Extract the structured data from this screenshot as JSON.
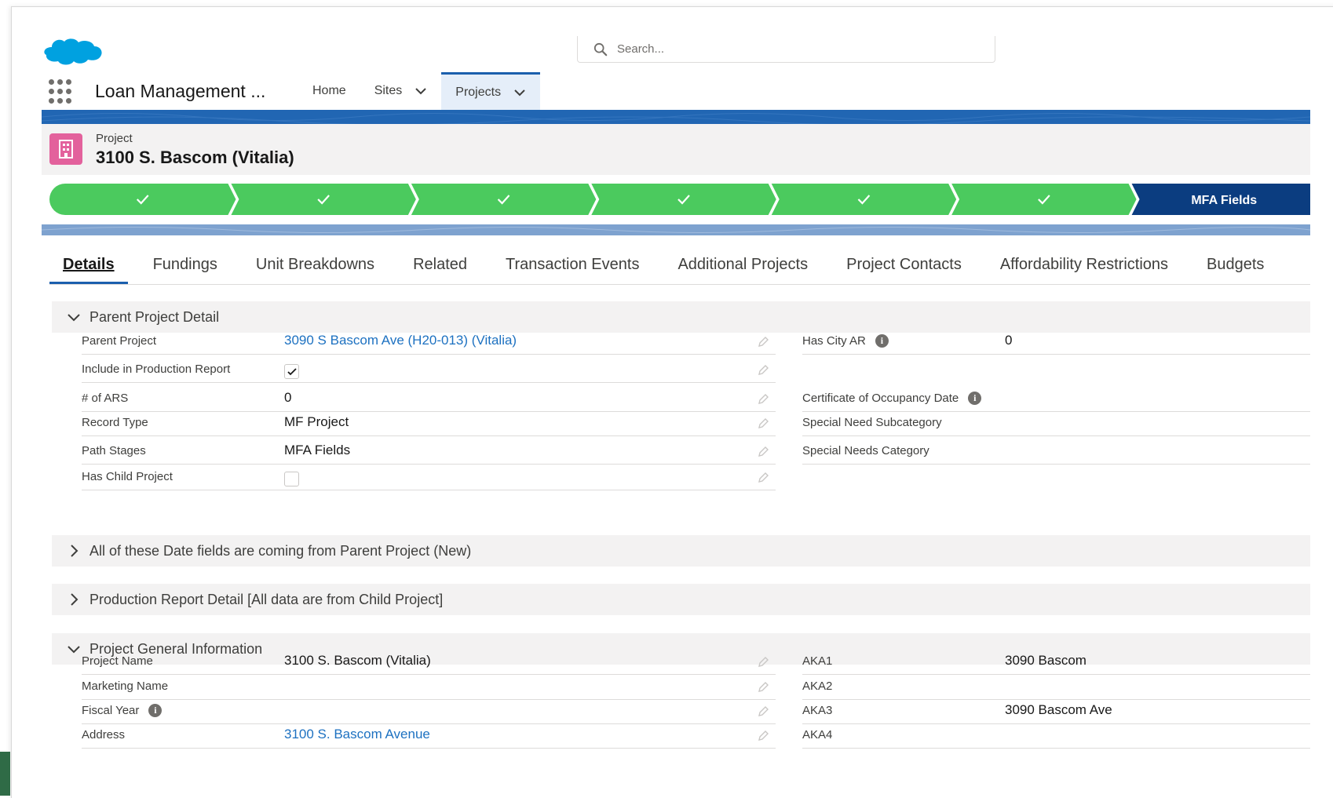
{
  "app": {
    "name": "Loan Management ..."
  },
  "search": {
    "placeholder": "Search..."
  },
  "nav": {
    "items": [
      {
        "label": "Home"
      },
      {
        "label": "Sites"
      },
      {
        "label": "Projects"
      }
    ]
  },
  "record": {
    "type": "Project",
    "name": "3100 S. Bascom (Vitalia)"
  },
  "path": {
    "current_stage": "MFA Fields",
    "completed_steps": 6
  },
  "tabs": [
    "Details",
    "Fundings",
    "Unit Breakdowns",
    "Related",
    "Transaction Events",
    "Additional Projects",
    "Project Contacts",
    "Affordability Restrictions",
    "Budgets"
  ],
  "sections": {
    "parent": {
      "title": "Parent Project Detail",
      "left": [
        {
          "label": "Parent Project",
          "value": "3090 S Bascom Ave (H20-013) (Vitalia)"
        },
        {
          "label": "Include in Production Report",
          "checked": true
        },
        {
          "label": "# of ARS",
          "value": "0"
        },
        {
          "label": "Record Type",
          "value": "MF Project"
        },
        {
          "label": "Path Stages",
          "value": "MFA Fields"
        },
        {
          "label": "Has Child Project",
          "checked": false
        }
      ],
      "right": [
        {
          "label": "Has City AR",
          "value": "0"
        },
        {
          "label": "Certificate of Occupancy Date",
          "value": ""
        },
        {
          "label": "Special Need Subcategory",
          "value": ""
        },
        {
          "label": "Special Needs Category",
          "value": ""
        }
      ]
    },
    "dates": {
      "title": "All of these Date fields are coming from Parent Project (New)"
    },
    "production": {
      "title": "Production Report Detail [All data are from Child Project]"
    },
    "general": {
      "title": "Project General Information",
      "left": [
        {
          "label": "Project Name",
          "value": "3100 S. Bascom (Vitalia)"
        },
        {
          "label": "Marketing Name",
          "value": ""
        },
        {
          "label": "Fiscal Year",
          "value": ""
        },
        {
          "label": "Address",
          "value": "3100 S. Bascom Avenue"
        }
      ],
      "right": [
        {
          "label": "AKA1",
          "value": "3090 Bascom"
        },
        {
          "label": "AKA2",
          "value": ""
        },
        {
          "label": "AKA3",
          "value": "3090 Bascom Ave"
        },
        {
          "label": "AKA4",
          "value": ""
        }
      ]
    }
  },
  "colors": {
    "brand": "#00a1e0",
    "path_complete": "#4bca5e",
    "path_current": "#0b3d80",
    "link": "#1d71c1",
    "record_icon": "#e3619c"
  }
}
